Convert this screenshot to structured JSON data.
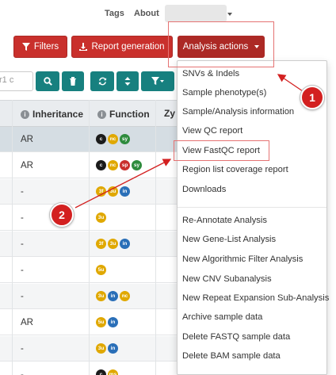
{
  "topnav": {
    "tags": "Tags",
    "about": "About"
  },
  "toolbar": {
    "filters": "Filters",
    "report_generation": "Report generation",
    "analysis_actions": "Analysis actions"
  },
  "search": {
    "placeholder": "r1 c"
  },
  "table": {
    "headers": {
      "inheritance": "Inheritance",
      "function": "Function",
      "zygosity": "Zy"
    },
    "rows": [
      {
        "inheritance": "AR",
        "badges": [
          "c",
          "nc",
          "sy"
        ]
      },
      {
        "inheritance": "AR",
        "badges": [
          "c",
          "nc",
          "sp",
          "sy"
        ]
      },
      {
        "inheritance": "-",
        "badges": [
          "3f",
          "3u",
          "in"
        ]
      },
      {
        "inheritance": "-",
        "badges": [
          "3u"
        ]
      },
      {
        "inheritance": "-",
        "badges": [
          "3f",
          "3u",
          "in"
        ]
      },
      {
        "inheritance": "-",
        "badges": [
          "5u"
        ]
      },
      {
        "inheritance": "-",
        "badges": [
          "3u",
          "in",
          "nc"
        ]
      },
      {
        "inheritance": "AR",
        "badges": [
          "5u",
          "in"
        ]
      },
      {
        "inheritance": "-",
        "badges": [
          "3u",
          "in"
        ]
      },
      {
        "inheritance": "-",
        "badges": [
          "c",
          "ms"
        ]
      }
    ]
  },
  "dropdown": {
    "items": [
      "SNVs & Indels",
      "Sample phenotype(s)",
      "Sample/Analysis information",
      "View QC report",
      "View FastQC report",
      "Region list coverage report",
      "Downloads",
      "Re-Annotate Analysis",
      "New Gene-List Analysis",
      "New Algorithmic Filter Analysis",
      "New CNV Subanalysis",
      "New Repeat Expansion Sub-Analysis",
      "Archive sample data",
      "Delete FASTQ sample data",
      "Delete BAM sample data"
    ]
  },
  "annotations": {
    "marker1": "1",
    "marker2": "2",
    "color": "#d32020"
  }
}
